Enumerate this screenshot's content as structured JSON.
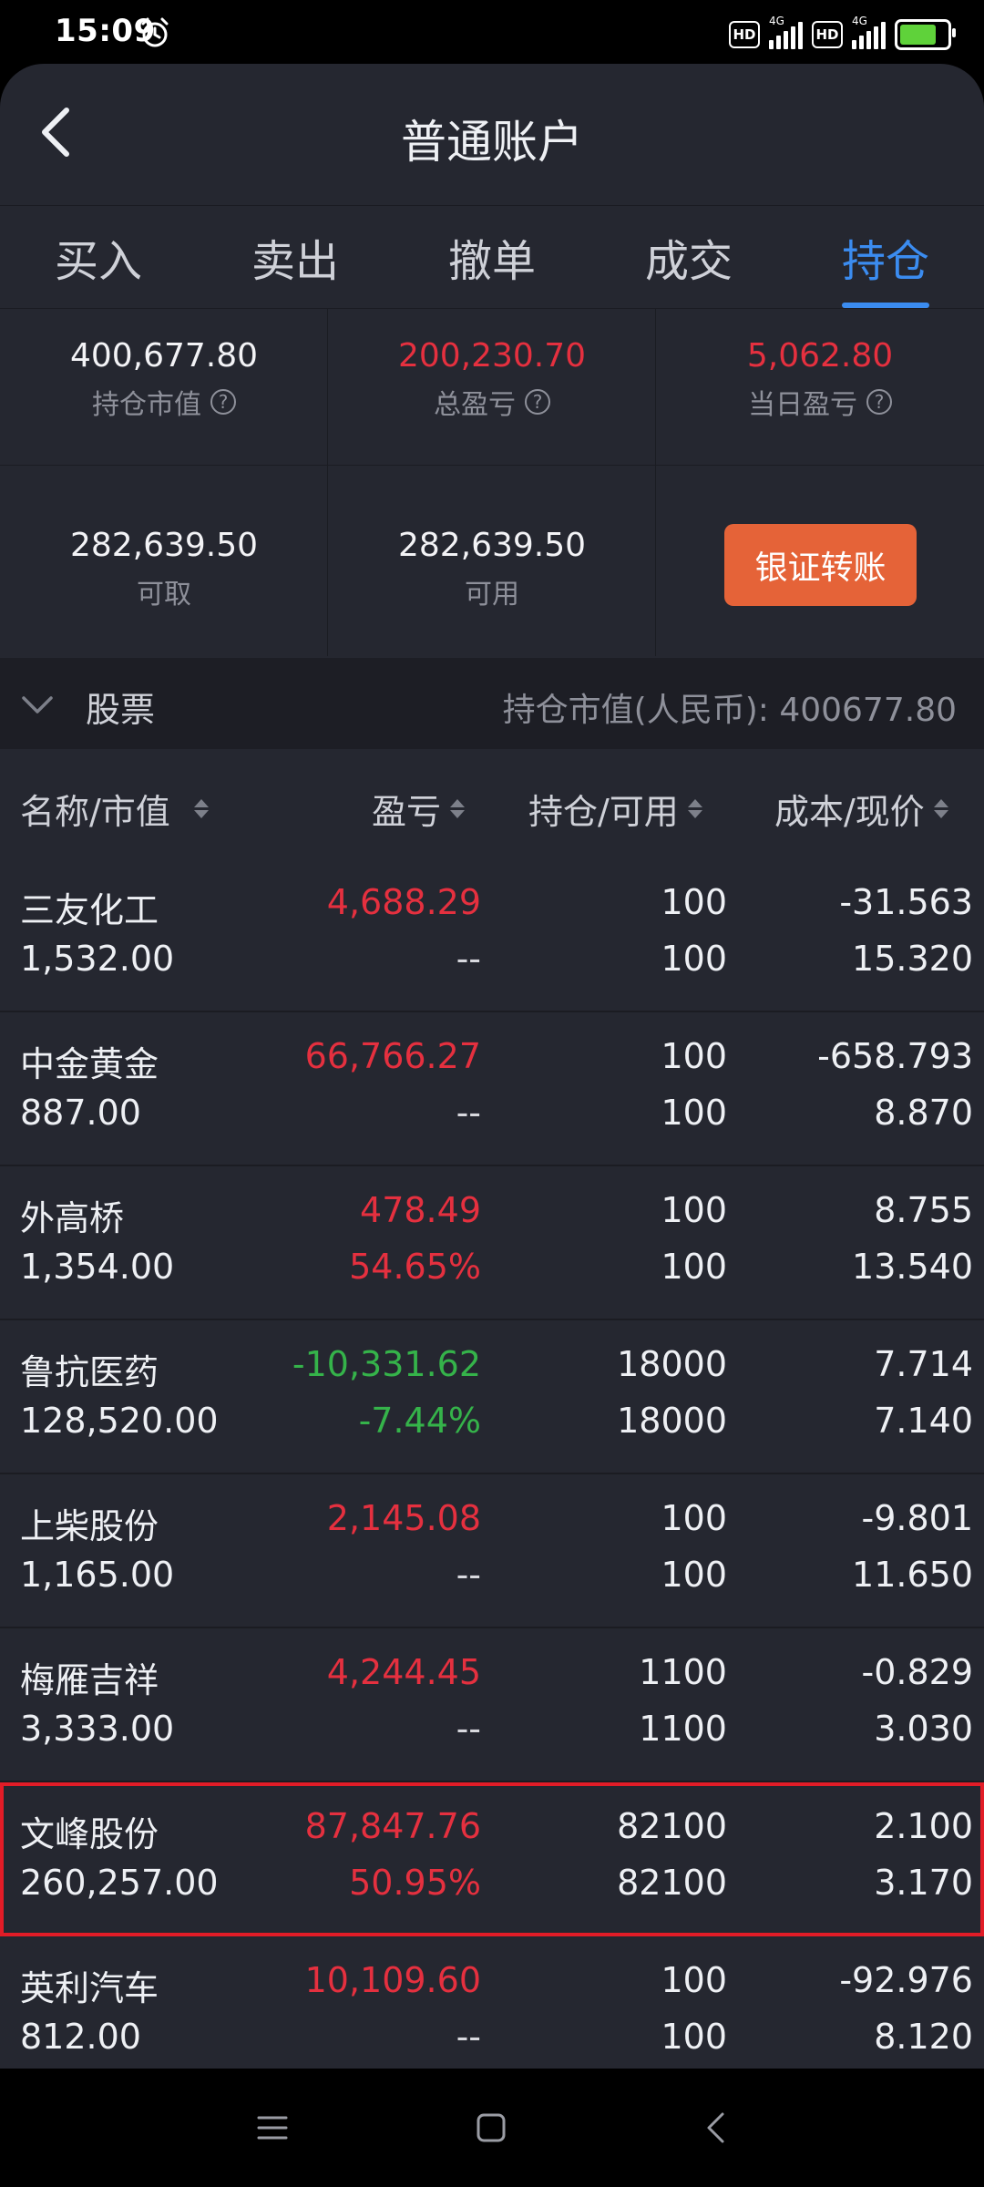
{
  "status_bar": {
    "time": "15:09",
    "network1": "4G",
    "network2": "4G",
    "hd1": "HD",
    "hd2": "HD"
  },
  "header": {
    "title": "普通账户"
  },
  "tabs": [
    {
      "label": "买入",
      "active": false
    },
    {
      "label": "卖出",
      "active": false
    },
    {
      "label": "撤单",
      "active": false
    },
    {
      "label": "成交",
      "active": false
    },
    {
      "label": "持仓",
      "active": true
    }
  ],
  "summary": {
    "market_value": {
      "value": "400,677.80",
      "label": "持仓市值"
    },
    "total_pnl": {
      "value": "200,230.70",
      "label": "总盈亏"
    },
    "daily_pnl": {
      "value": "5,062.80",
      "label": "当日盈亏"
    },
    "withdrawable": {
      "value": "282,639.50",
      "label": "可取"
    },
    "available": {
      "value": "282,639.50",
      "label": "可用"
    },
    "transfer_button": "银证转账"
  },
  "section": {
    "title": "股票",
    "summary": "持仓市值(人民币): 400677.80"
  },
  "columns": {
    "name": "名称/市值",
    "pnl": "盈亏",
    "holding": "持仓/可用",
    "cost": "成本/现价"
  },
  "holdings": [
    {
      "name": "三友化工",
      "market_value": "1,532.00",
      "pnl": "4,688.29",
      "pnl_pct": "--",
      "holding": "100",
      "available": "100",
      "cost": "-31.563",
      "price": "15.320",
      "pnl_color": "red",
      "pct_color": "neutral",
      "highlight": false
    },
    {
      "name": "中金黄金",
      "market_value": "887.00",
      "pnl": "66,766.27",
      "pnl_pct": "--",
      "holding": "100",
      "available": "100",
      "cost": "-658.793",
      "price": "8.870",
      "pnl_color": "red",
      "pct_color": "neutral",
      "highlight": false
    },
    {
      "name": "外高桥",
      "market_value": "1,354.00",
      "pnl": "478.49",
      "pnl_pct": "54.65%",
      "holding": "100",
      "available": "100",
      "cost": "8.755",
      "price": "13.540",
      "pnl_color": "red",
      "pct_color": "red",
      "highlight": false
    },
    {
      "name": "鲁抗医药",
      "market_value": "128,520.00",
      "pnl": "-10,331.62",
      "pnl_pct": "-7.44%",
      "holding": "18000",
      "available": "18000",
      "cost": "7.714",
      "price": "7.140",
      "pnl_color": "green",
      "pct_color": "green",
      "highlight": false
    },
    {
      "name": "上柴股份",
      "market_value": "1,165.00",
      "pnl": "2,145.08",
      "pnl_pct": "--",
      "holding": "100",
      "available": "100",
      "cost": "-9.801",
      "price": "11.650",
      "pnl_color": "red",
      "pct_color": "neutral",
      "highlight": false
    },
    {
      "name": "梅雁吉祥",
      "market_value": "3,333.00",
      "pnl": "4,244.45",
      "pnl_pct": "--",
      "holding": "1100",
      "available": "1100",
      "cost": "-0.829",
      "price": "3.030",
      "pnl_color": "red",
      "pct_color": "neutral",
      "highlight": false
    },
    {
      "name": "文峰股份",
      "market_value": "260,257.00",
      "pnl": "87,847.76",
      "pnl_pct": "50.95%",
      "holding": "82100",
      "available": "82100",
      "cost": "2.100",
      "price": "3.170",
      "pnl_color": "red",
      "pct_color": "red",
      "highlight": true
    },
    {
      "name": "英利汽车",
      "market_value": "812.00",
      "pnl": "10,109.60",
      "pnl_pct": "--",
      "holding": "100",
      "available": "100",
      "cost": "-92.976",
      "price": "8.120",
      "pnl_color": "red",
      "pct_color": "neutral",
      "highlight": false
    }
  ],
  "colors": {
    "accent_blue": "#3b8cf0",
    "red": "#e5303f",
    "green": "#35b34a",
    "button_orange": "#e56338",
    "highlight_border": "#e21c27"
  }
}
